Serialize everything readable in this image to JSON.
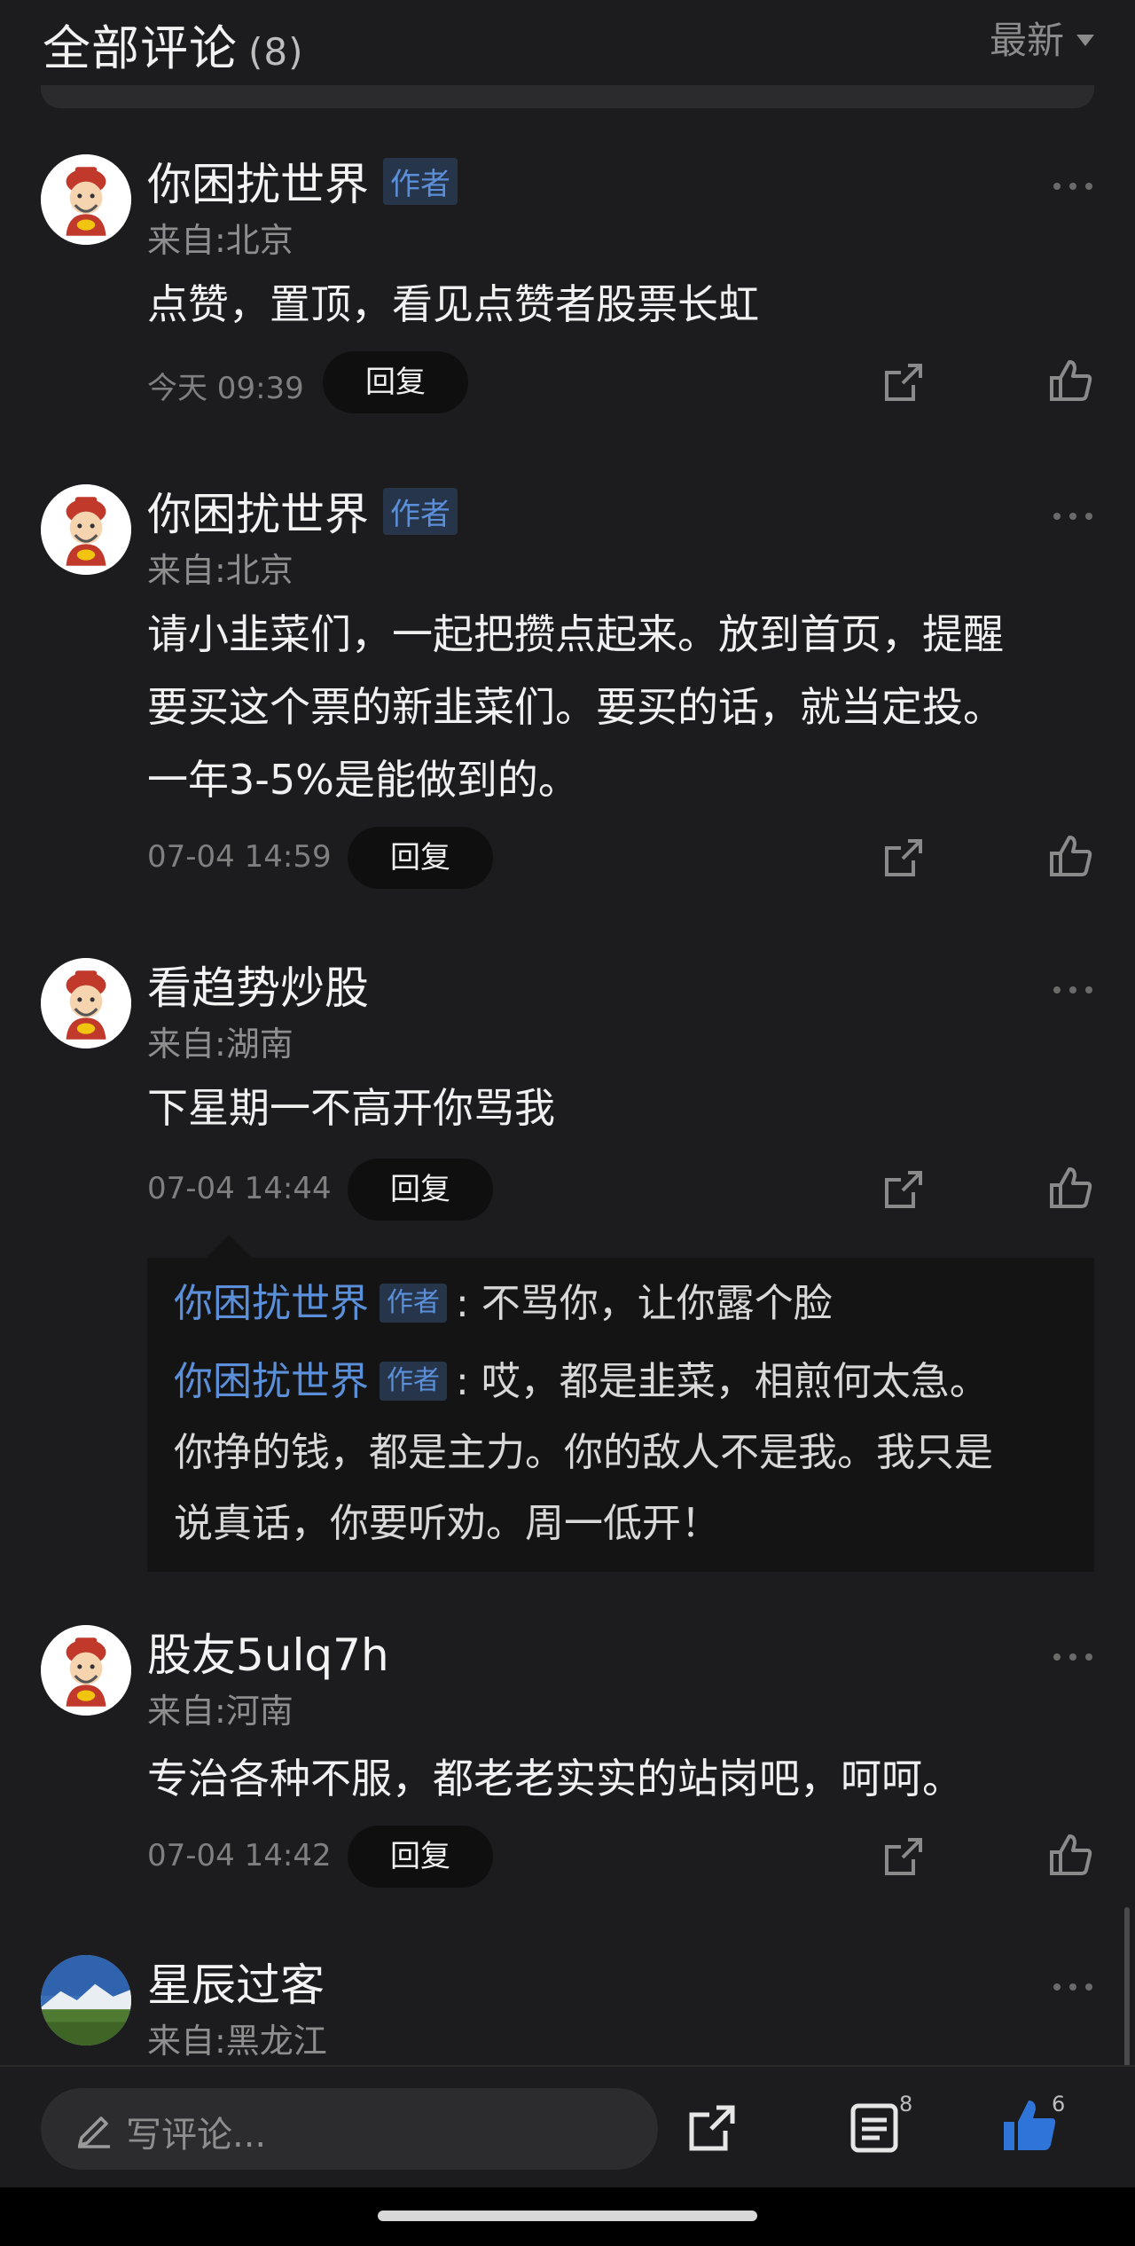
{
  "header": {
    "title": "全部评论",
    "count": "(8)",
    "sort_label": "最新"
  },
  "comments": [
    {
      "name": "你困扰世界",
      "author_tag": "作者",
      "location": "来自:北京",
      "body_lines": [
        "点赞，置顶，看见点赞者股票长虹"
      ],
      "time": "今天 09:39",
      "reply_label": "回复"
    },
    {
      "name": "你困扰世界",
      "author_tag": "作者",
      "location": "来自:北京",
      "body_lines": [
        "请小韭菜们，一起把攒点起来。放到首页，提醒",
        "要买这个票的新韭菜们。要买的话，就当定投。",
        "一年3-5%是能做到的。"
      ],
      "time": "07-04 14:59",
      "reply_label": "回复"
    },
    {
      "name": "看趋势炒股",
      "location": "来自:湖南",
      "body_lines": [
        "下星期一不高开你骂我"
      ],
      "time": "07-04 14:44",
      "reply_label": "回复",
      "replies": [
        {
          "name": "你困扰世界",
          "tag": "作者",
          "text_lines": [
            ": 不骂你，让你露个脸"
          ]
        },
        {
          "name": "你困扰世界",
          "tag": "作者",
          "text_lines": [
            ": 哎，都是韭菜，相煎何太急。",
            "你挣的钱，都是主力。你的敌人不是我。我只是",
            "说真话，你要听劝。周一低开！"
          ]
        }
      ]
    },
    {
      "name": "股友5ulq7h",
      "location": "来自:河南",
      "body_lines": [
        "专治各种不服，都老老实实的站岗吧，呵呵。"
      ],
      "time": "07-04 14:42",
      "reply_label": "回复"
    },
    {
      "name": "星辰过客",
      "location": "来自:黑龙江"
    }
  ],
  "bottom_bar": {
    "input_placeholder": "写评论...",
    "comment_count": "8",
    "like_count": "6"
  },
  "colors": {
    "background": "#1c1c1e",
    "accent": "#5b8fd9",
    "like_active": "#2f74d9"
  },
  "icons": [
    "more-icon",
    "share-icon",
    "like-icon",
    "pen-icon",
    "list-icon"
  ]
}
